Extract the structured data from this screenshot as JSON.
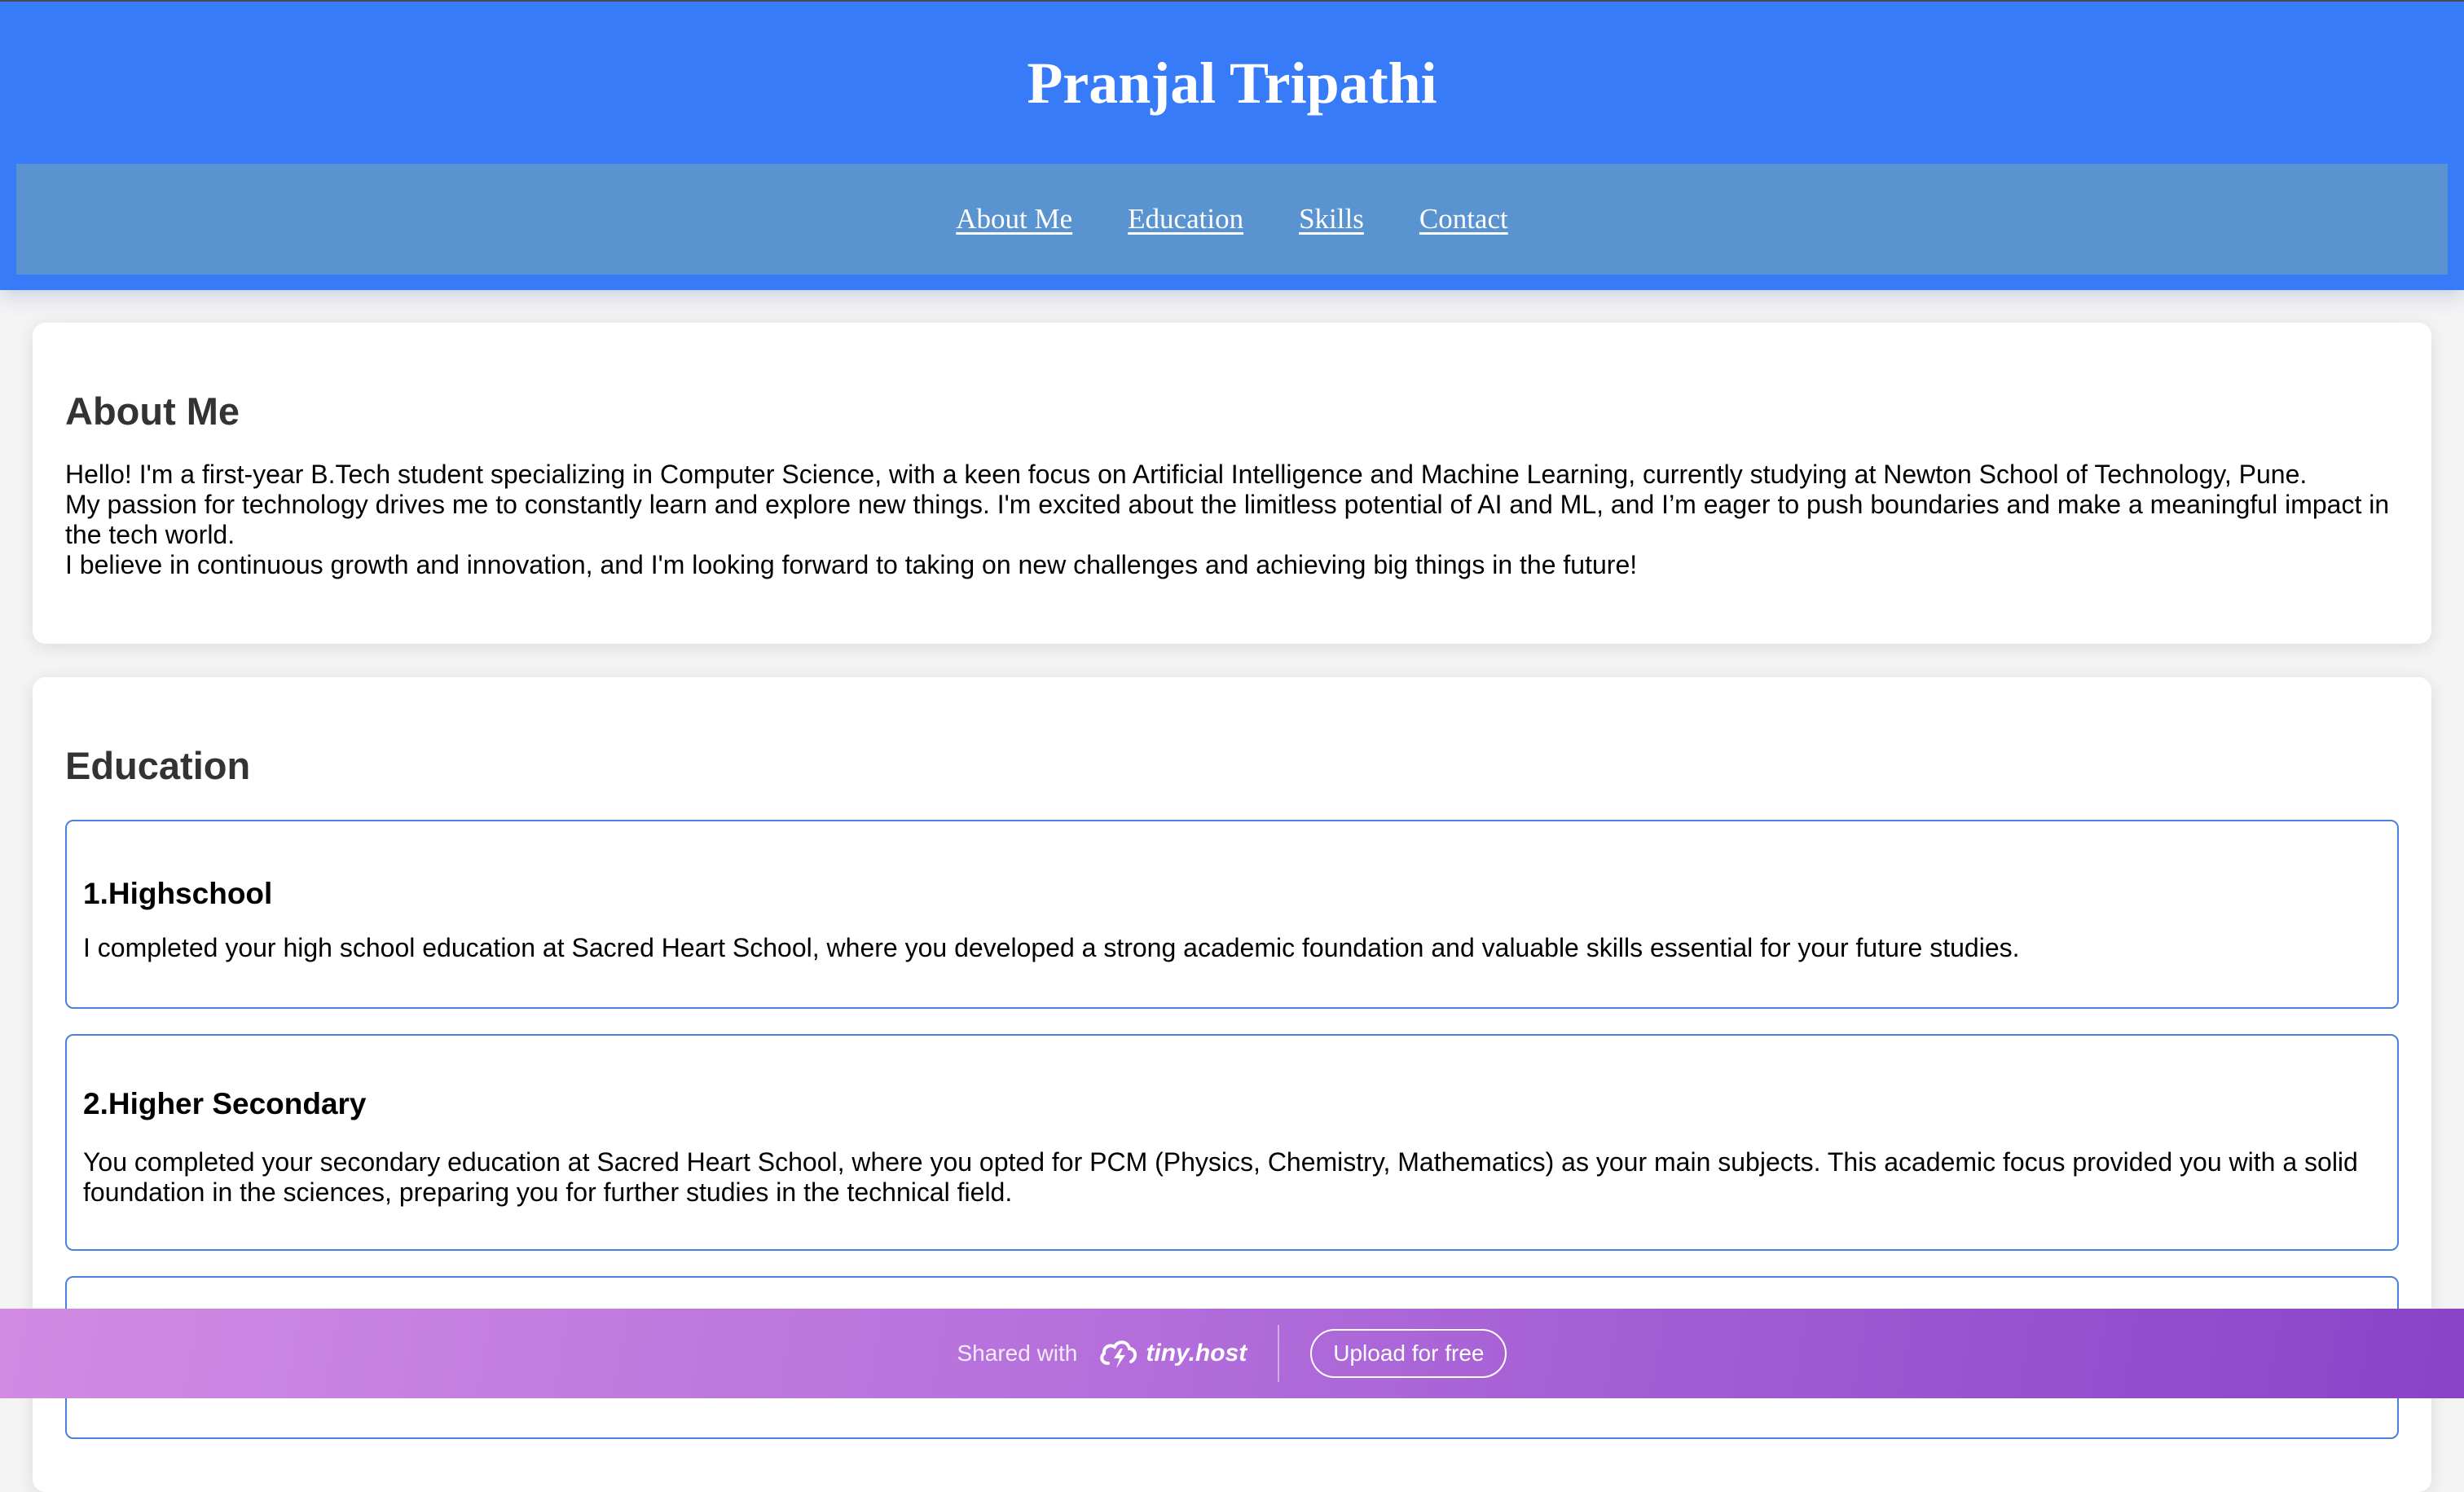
{
  "header": {
    "title": "Pranjal Tripathi"
  },
  "nav": {
    "items": [
      {
        "label": "About Me"
      },
      {
        "label": "Education"
      },
      {
        "label": "Skills"
      },
      {
        "label": "Contact"
      }
    ]
  },
  "about": {
    "heading": "About Me",
    "lines": [
      "Hello! I'm a first-year B.Tech student specializing in Computer Science, with a keen focus on Artificial Intelligence and Machine Learning, currently studying at Newton School of Technology, Pune.",
      "My passion for technology drives me to constantly learn and explore new things. I'm excited about the limitless potential of AI and ML, and I’m eager to push boundaries and make a meaningful impact in the tech world.",
      "I believe in continuous growth and innovation, and I'm looking forward to taking on new challenges and achieving big things in the future!"
    ]
  },
  "education": {
    "heading": "Education",
    "items": [
      {
        "title": "1.Highschool",
        "text": "I completed your high school education at Sacred Heart School, where you developed a strong academic foundation and valuable skills essential for your future studies."
      },
      {
        "title": "2.Higher Secondary",
        "text": "You completed your secondary education at Sacred Heart School, where you opted for PCM (Physics, Chemistry, Mathematics) as your main subjects. This academic focus provided you with a solid foundation in the sciences, preparing you for further studies in the technical field."
      }
    ]
  },
  "banner": {
    "shared_with": "Shared with",
    "brand": "tiny.host",
    "upload_label": "Upload for free",
    "logo_icon": "lightning-cloud-icon"
  },
  "colors": {
    "header_bg": "#377bf8",
    "nav_bg": "#5994d1",
    "edu_border": "#4a80e0"
  }
}
